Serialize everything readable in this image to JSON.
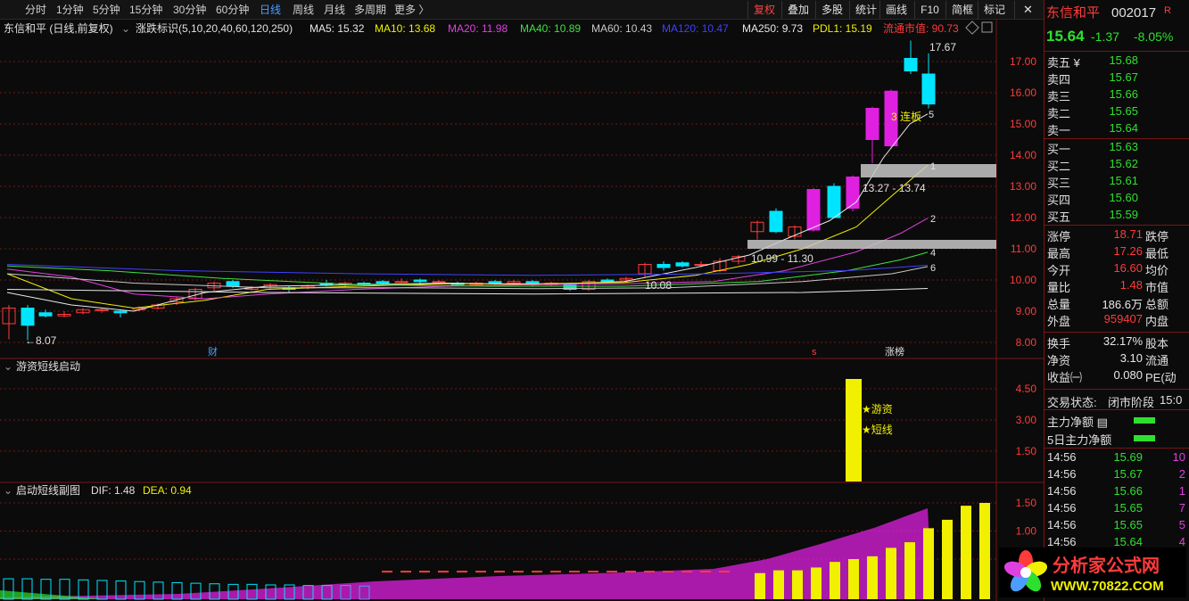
{
  "toolbar": {
    "periods": [
      "分时",
      "1分钟",
      "5分钟",
      "15分钟",
      "30分钟",
      "60分钟",
      "日线",
      "周线",
      "月线",
      "多周期",
      "更多 〉"
    ],
    "active_period": "日线",
    "tools": [
      "复权",
      "叠加",
      "多股",
      "统计",
      "画线",
      "F10",
      "简框",
      "标记"
    ],
    "active_tool": "复权",
    "close_icon": "close-icon"
  },
  "main_panel": {
    "title": "东信和平 (日线,前复权)",
    "indicator_name": "涨跌标识(5,10,20,40,60,120,250)",
    "ma_readouts": [
      {
        "label": "MA5: 15.32",
        "color": "#e8e8e8"
      },
      {
        "label": "MA10: 13.68",
        "color": "#f0f000"
      },
      {
        "label": "MA20: 11.98",
        "color": "#e040e0"
      },
      {
        "label": "MA40: 10.89",
        "color": "#40e040"
      },
      {
        "label": "MA60: 10.43",
        "color": "#c8c8c8"
      },
      {
        "label": "MA120: 10.47",
        "color": "#4040ff"
      },
      {
        "label": "MA250: 9.73",
        "color": "#e8e8e8"
      },
      {
        "label": "PDL1: 15.19",
        "color": "#f0f000"
      },
      {
        "label": "流通市值: 90.73",
        "color": "#ff3b3b"
      }
    ],
    "diamond_icon": "diamond-icon",
    "price_axis": [
      "17.00",
      "16.00",
      "15.00",
      "14.00",
      "13.00",
      "12.00",
      "11.00",
      "10.00",
      "9.00",
      "8.00"
    ],
    "annotations": {
      "high": "17.67",
      "low": "8.07",
      "mid": "10.08",
      "range1": "13.27 - 13.74",
      "range2": "10.99 - 11.30",
      "lianban": "3 连板",
      "bands": [
        "1",
        "2",
        "4",
        "6"
      ],
      "five": "5",
      "marker_cai": "财",
      "marker_s": "s",
      "marker_zhangbang": "涨榜"
    }
  },
  "sub1": {
    "title": "游资短线启动",
    "axis": [
      "4.50",
      "3.00",
      "1.50"
    ],
    "labels": [
      "★游资",
      "★短线"
    ]
  },
  "sub2": {
    "title": "启动短线副图",
    "dif": "DIF: 1.48",
    "dea": "DEA: 0.94",
    "axis": [
      "1.50",
      "1.00",
      "0.50"
    ]
  },
  "colors": {
    "up": "#ff3b3b",
    "down": "#00e5ff",
    "yellow": "#f0f000",
    "magenta": "#e020e0",
    "bg": "#0b0b0b",
    "grid": "#7a1414"
  },
  "quote": {
    "name": "东信和平",
    "code": "002017",
    "suffix": "R",
    "price": "15.64",
    "change": "-1.37",
    "pct": "-8.05%",
    "sell": [
      {
        "label": "卖五",
        "flag": "¥",
        "price": "15.68"
      },
      {
        "label": "卖四",
        "price": "15.67"
      },
      {
        "label": "卖三",
        "price": "15.66"
      },
      {
        "label": "卖二",
        "price": "15.65"
      },
      {
        "label": "卖一",
        "price": "15.64"
      }
    ],
    "buy": [
      {
        "label": "买一",
        "price": "15.63"
      },
      {
        "label": "买二",
        "price": "15.62"
      },
      {
        "label": "买三",
        "price": "15.61"
      },
      {
        "label": "买四",
        "price": "15.60"
      },
      {
        "label": "买五",
        "price": "15.59"
      }
    ],
    "stats": [
      {
        "label": "涨停",
        "value": "18.71",
        "color": "red",
        "label2": "跌停"
      },
      {
        "label": "最高",
        "value": "17.26",
        "color": "red",
        "label2": "最低"
      },
      {
        "label": "今开",
        "value": "16.60",
        "color": "red",
        "label2": "均价"
      },
      {
        "label": "量比",
        "value": "1.48",
        "color": "red",
        "label2": "市值"
      },
      {
        "label": "总量",
        "value": "186.6万",
        "color": "white",
        "label2": "总额"
      },
      {
        "label": "外盘",
        "value": "959407",
        "color": "red",
        "label2": "内盘"
      }
    ],
    "stats2": [
      {
        "label": "换手",
        "value": "32.17%",
        "label2": "股本"
      },
      {
        "label": "净资",
        "value": "3.10",
        "label2": "流通"
      },
      {
        "label": "收益㈠",
        "value": "0.080",
        "label2": "PE(动"
      }
    ],
    "trade_status_label": "交易状态:",
    "trade_status": "闭市阶段",
    "trade_time": "15:0",
    "net_main": "主力净额",
    "net_main5": "5日主力净额",
    "ticks": [
      {
        "time": "14:56",
        "price": "15.69",
        "vol": "10"
      },
      {
        "time": "14:56",
        "price": "15.67",
        "vol": "2"
      },
      {
        "time": "14:56",
        "price": "15.66",
        "vol": "1"
      },
      {
        "time": "14:56",
        "price": "15.65",
        "vol": "7"
      },
      {
        "time": "14:56",
        "price": "15.65",
        "vol": "5"
      },
      {
        "time": "14:56",
        "price": "15.64",
        "vol": "4"
      }
    ]
  },
  "logo": {
    "title": "分析家公式网",
    "url": "WWW.70822.COM"
  }
}
